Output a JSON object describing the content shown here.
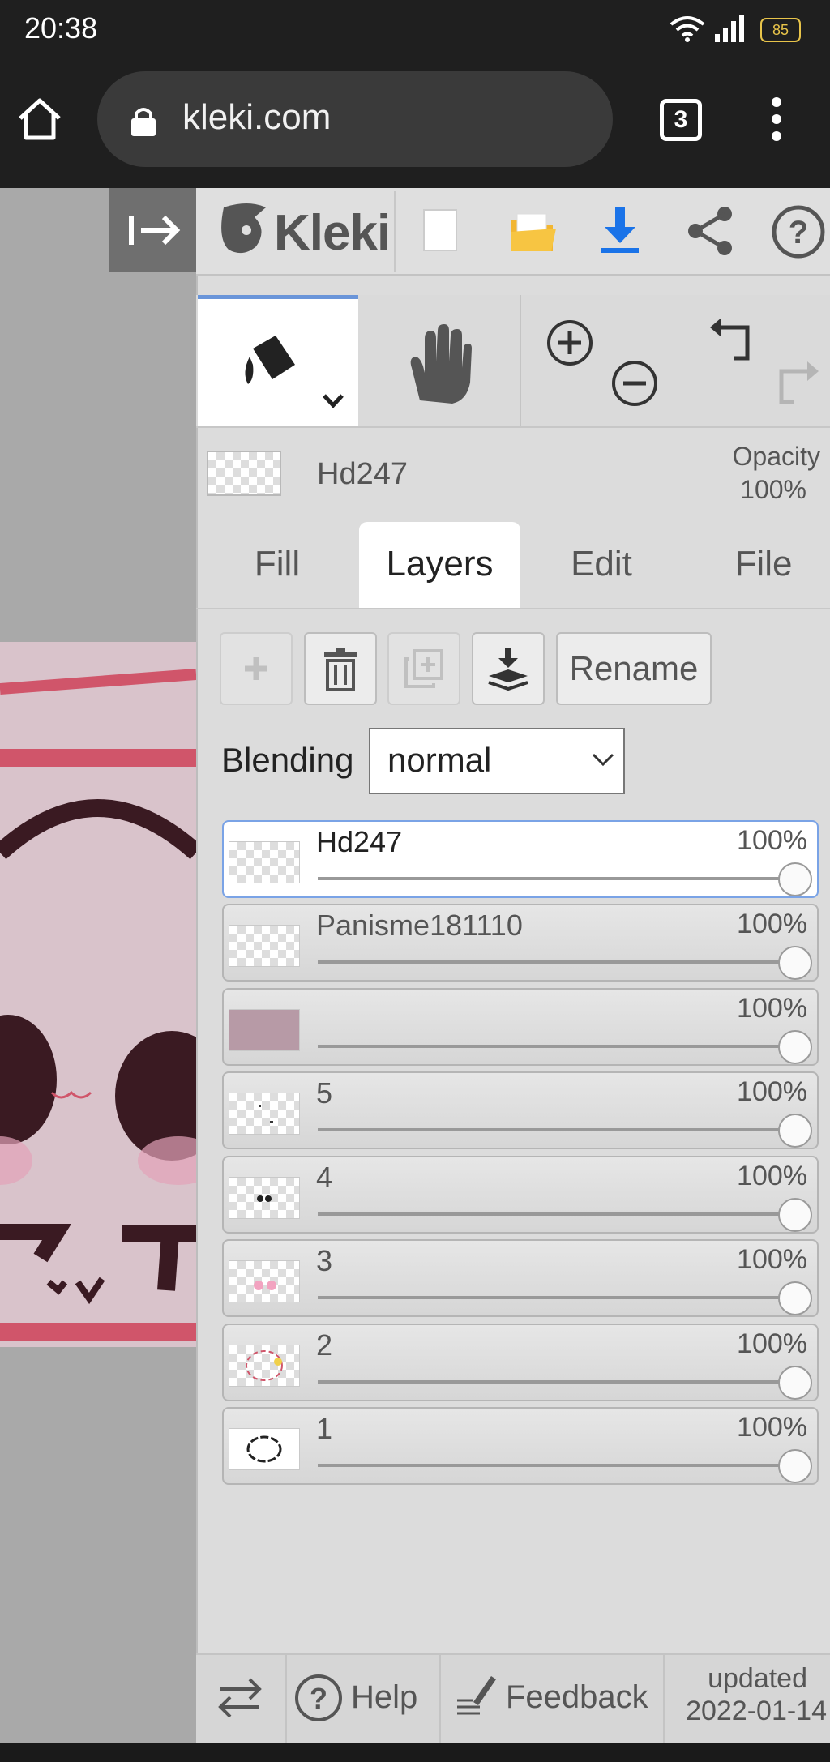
{
  "status_bar": {
    "time": "20:38",
    "battery": "85"
  },
  "browser": {
    "url": "kleki.com",
    "tab_count": "3"
  },
  "header": {
    "app_name": "Kleki"
  },
  "current_layer": {
    "name": "Hd247",
    "opacity_label": "Opacity",
    "opacity_value": "100%"
  },
  "tabs": [
    "Fill",
    "Layers",
    "Edit",
    "File"
  ],
  "layer_toolbar": {
    "rename_label": "Rename"
  },
  "blending": {
    "label": "Blending",
    "value": "normal"
  },
  "layers": [
    {
      "name": "Hd247",
      "opacity": "100%",
      "active": true,
      "thumb": "checker"
    },
    {
      "name": "Panisme181110",
      "opacity": "100%",
      "active": false,
      "thumb": "checker"
    },
    {
      "name": "",
      "opacity": "100%",
      "active": false,
      "thumb": "pink"
    },
    {
      "name": "5",
      "opacity": "100%",
      "active": false,
      "thumb": "checker-dots"
    },
    {
      "name": "4",
      "opacity": "100%",
      "active": false,
      "thumb": "checker-eyes"
    },
    {
      "name": "3",
      "opacity": "100%",
      "active": false,
      "thumb": "checker-cheeks"
    },
    {
      "name": "2",
      "opacity": "100%",
      "active": false,
      "thumb": "checker-outline"
    },
    {
      "name": "1",
      "opacity": "100%",
      "active": false,
      "thumb": "white-outline"
    }
  ],
  "footer": {
    "help_label": "Help",
    "feedback_label": "Feedback",
    "updated_label": "updated",
    "updated_date": "2022-01-14"
  },
  "colors": {
    "accent": "#6a95d9",
    "download_blue": "#1a73e8",
    "folder_yellow": "#f2b632",
    "artwork_pink": "#d9c3cb",
    "stripe_red": "#d0556a"
  }
}
